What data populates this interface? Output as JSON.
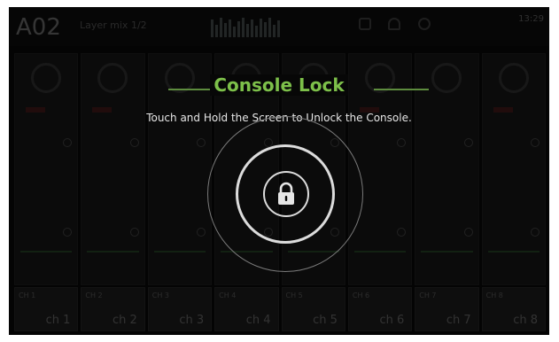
{
  "header": {
    "scene_number": "A02",
    "scene_name": "Layer mix 1/2",
    "clock": "13:29"
  },
  "icons": {
    "lock": "lock-icon",
    "headphones": "headphones-icon",
    "settings": "gear-icon"
  },
  "channels": [
    {
      "label": "ch 1",
      "small": "CH 1"
    },
    {
      "label": "ch 2",
      "small": "CH 2"
    },
    {
      "label": "ch 3",
      "small": "CH 3"
    },
    {
      "label": "ch 4",
      "small": "CH 4"
    },
    {
      "label": "ch 5",
      "small": "CH 5"
    },
    {
      "label": "ch 6",
      "small": "CH 6"
    },
    {
      "label": "ch 7",
      "small": "CH 7"
    },
    {
      "label": "ch 8",
      "small": "CH 8"
    }
  ],
  "lock_dialog": {
    "title": "Console Lock",
    "message": "Touch and Hold the Screen to Unlock the Console."
  },
  "colors": {
    "accent": "#7dc04a",
    "background": "#070707"
  }
}
